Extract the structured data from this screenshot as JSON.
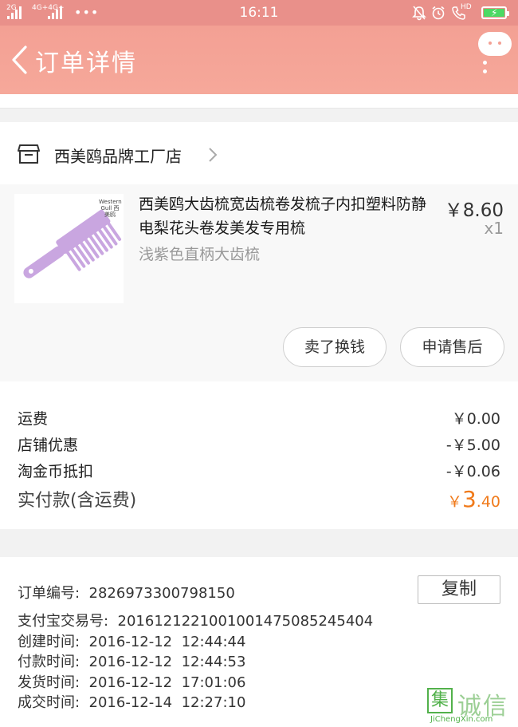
{
  "status_bar": {
    "sim1": "2G",
    "sim2": "4G+4G+",
    "more": "•••",
    "time": "16:11",
    "hd": "HD"
  },
  "header": {
    "title": "订单详情"
  },
  "store": {
    "name": "西美鸥品牌工厂店",
    "icon": "store-icon"
  },
  "product": {
    "title": "西美鸥大齿梳宽齿梳卷发梳子内扣塑料防静电梨花头卷发美发专用梳",
    "variant": "浅紫色直柄大齿梳",
    "price": "￥8.60",
    "quantity": "x1",
    "brand_logo": "Western Gull 西美鸥",
    "image_color": "#c9a6e0"
  },
  "actions": {
    "resell_label": "卖了换钱",
    "after_sale_label": "申请售后"
  },
  "costs": {
    "shipping_label": "运费",
    "shipping_value": "￥0.00",
    "store_discount_label": "店铺优惠",
    "store_discount_value": "-￥5.00",
    "coin_label": "淘金币抵扣",
    "coin_value": "-￥0.06",
    "total_label": "实付款(含运费)",
    "total_currency": "￥",
    "total_int": "3",
    "total_dec": ".40",
    "accent_color": "#f07a1a"
  },
  "order": {
    "number_label": "订单编号:",
    "number_value": "2826973300798150",
    "copy_label": "复制",
    "alipay_label": "支付宝交易号:",
    "alipay_value": "2016121221001001475085245404",
    "created_label": "创建时间:",
    "created_value": "2016-12-12  12:44:44",
    "paid_label": "付款时间:",
    "paid_value": "2016-12-12  12:44:53",
    "shipped_label": "发货时间:",
    "shipped_value": "2016-12-12  17:01:06",
    "completed_label": "成交时间:",
    "completed_value": "2016-12-14  12:27:10"
  },
  "watermark": {
    "box_char": "集",
    "chars": "诚信",
    "url": "JiChengXin.com"
  },
  "colors": {
    "header": "#f3a094",
    "status_bar": "#e9908a"
  }
}
